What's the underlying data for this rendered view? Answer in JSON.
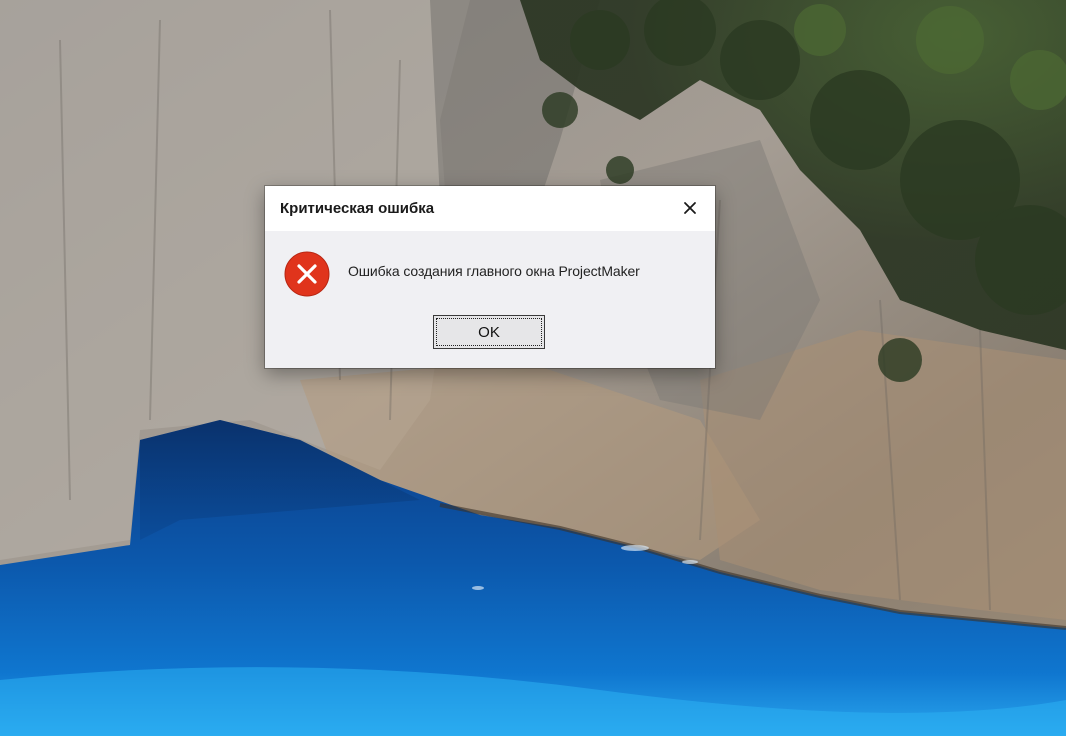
{
  "dialog": {
    "title": "Критическая ошибка",
    "close_icon": "close-icon",
    "error_icon": "error-icon",
    "message": "Ошибка создания главного окна ProjectMaker",
    "ok_label": "OK"
  },
  "colors": {
    "dialog_background": "#f0f0f3",
    "titlebar_background": "#ffffff",
    "error_red": "#e0341c",
    "sea_blue": "#0a5fb0"
  }
}
